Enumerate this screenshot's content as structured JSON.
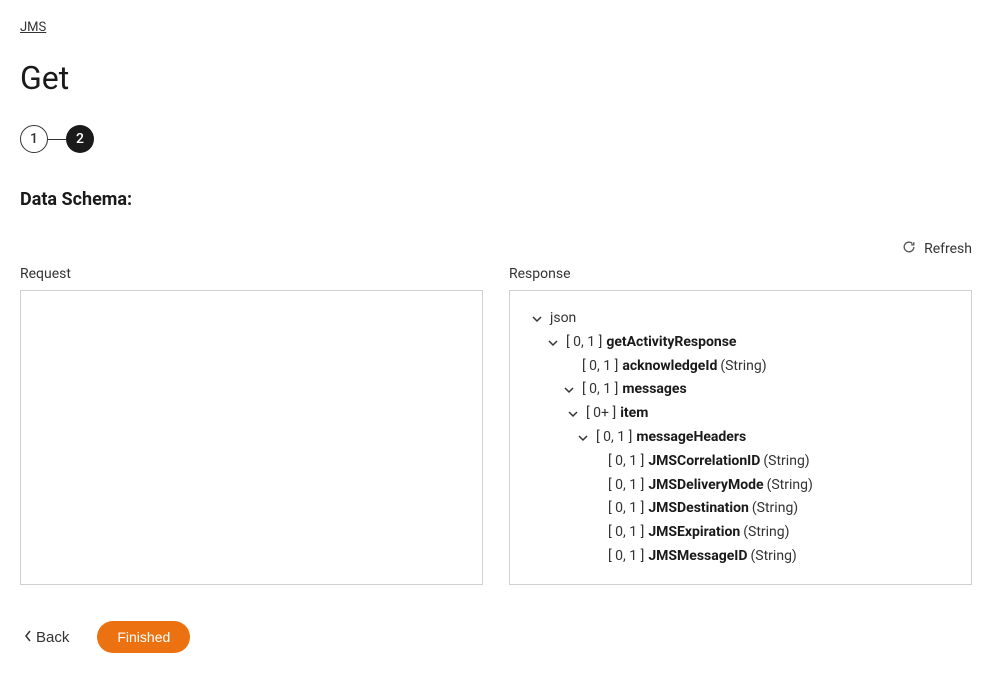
{
  "breadcrumb": {
    "label": "JMS"
  },
  "page": {
    "title": "Get"
  },
  "stepper": {
    "step1": "1",
    "step2": "2"
  },
  "section": {
    "title": "Data Schema:"
  },
  "refresh": {
    "label": "Refresh"
  },
  "panels": {
    "request_label": "Request",
    "response_label": "Response"
  },
  "tree": {
    "root": "json",
    "n1_card": "[ 0, 1 ]",
    "n1_name": "getActivityResponse",
    "n2_card": "[ 0, 1 ]",
    "n2_name": "acknowledgeId",
    "n2_type": "(String)",
    "n3_card": "[ 0, 1 ]",
    "n3_name": "messages",
    "n4_card": "[ 0+ ]",
    "n4_name": "item",
    "n5_card": "[ 0, 1 ]",
    "n5_name": "messageHeaders",
    "n6_card": "[ 0, 1 ]",
    "n6_name": "JMSCorrelationID",
    "n6_type": "(String)",
    "n7_card": "[ 0, 1 ]",
    "n7_name": "JMSDeliveryMode",
    "n7_type": "(String)",
    "n8_card": "[ 0, 1 ]",
    "n8_name": "JMSDestination",
    "n8_type": "(String)",
    "n9_card": "[ 0, 1 ]",
    "n9_name": "JMSExpiration",
    "n9_type": "(String)",
    "n10_card": "[ 0, 1 ]",
    "n10_name": "JMSMessageID",
    "n10_type": "(String)"
  },
  "footer": {
    "back": "Back",
    "finished": "Finished"
  }
}
